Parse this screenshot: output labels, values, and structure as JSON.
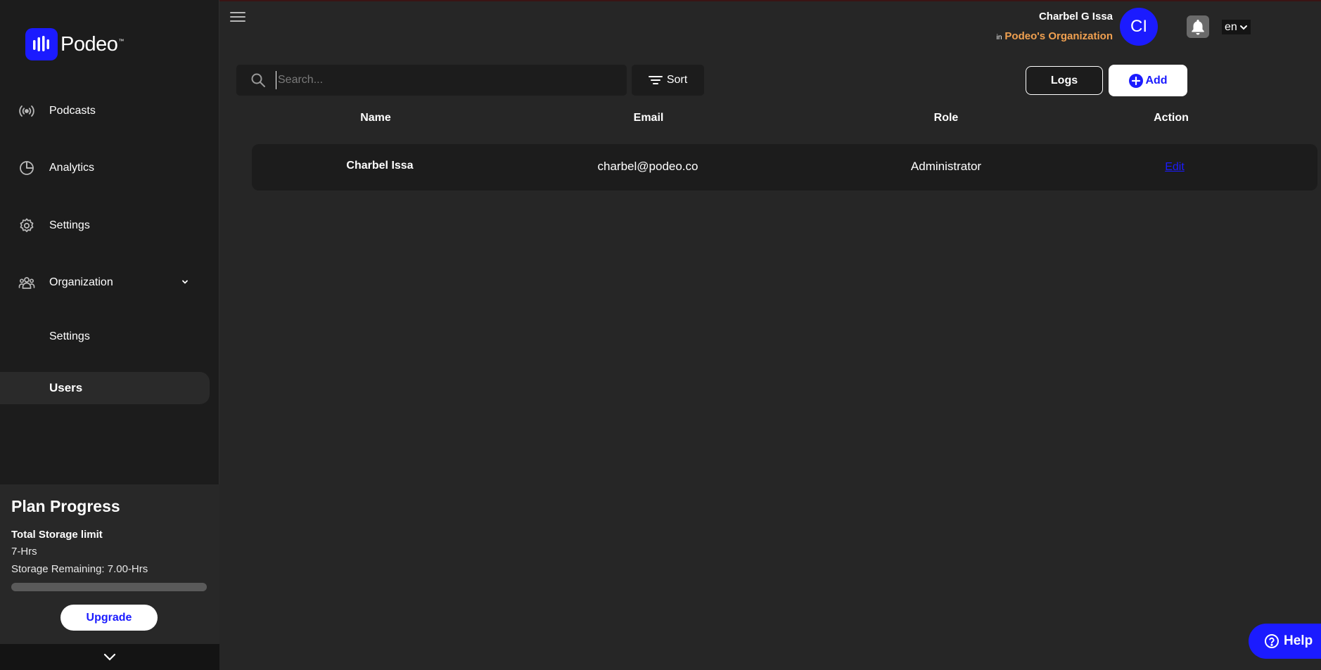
{
  "brand": {
    "name": "Podeo",
    "tm": "™"
  },
  "sidebar": {
    "items": [
      {
        "label": "Podcasts",
        "icon": "podcast-icon"
      },
      {
        "label": "Analytics",
        "icon": "pie-chart-icon"
      },
      {
        "label": "Settings",
        "icon": "gear-icon"
      },
      {
        "label": "Organization",
        "icon": "people-icon"
      },
      {
        "label": "Settings"
      },
      {
        "label": "Users",
        "active": true
      }
    ]
  },
  "plan": {
    "title": "Plan Progress",
    "storage_label": "Total Storage limit",
    "storage_limit": "7-Hrs",
    "remaining": "Storage Remaining: 7.00-Hrs",
    "used_fraction": 0,
    "upgrade_label": "Upgrade"
  },
  "header": {
    "user_name": "Charbel G Issa",
    "org_prefix": "in",
    "org_name": "Podeo's Organization",
    "avatar_initials": "CI",
    "language": "en"
  },
  "toolbar": {
    "search_placeholder": "Search...",
    "sort_label": "Sort",
    "logs_label": "Logs",
    "add_label": "Add"
  },
  "table": {
    "columns": [
      "Name",
      "Email",
      "Role",
      "Action"
    ],
    "rows": [
      {
        "name": "Charbel Issa",
        "email": "charbel@podeo.co",
        "role": "Administrator",
        "action": "Edit"
      }
    ]
  },
  "help": {
    "label": "Help"
  },
  "colors": {
    "accent": "#1b1bff",
    "org": "#f0a050",
    "background": "#262626",
    "sidebar": "#1c1c1c"
  }
}
